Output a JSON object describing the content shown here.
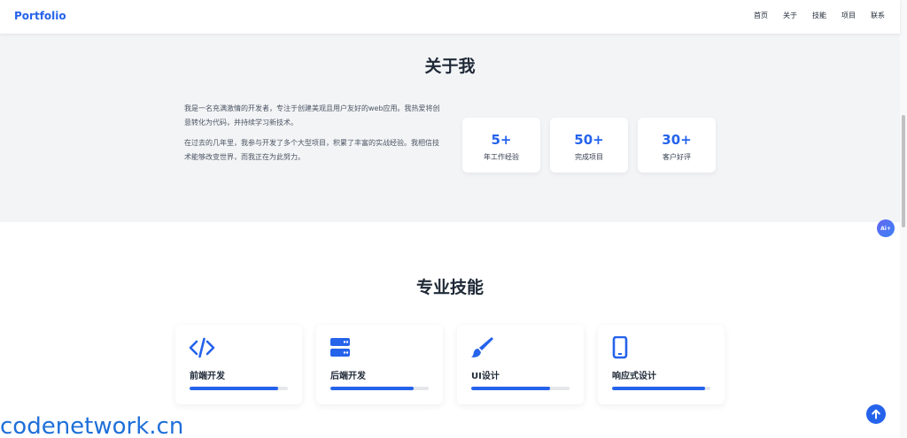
{
  "nav": {
    "logo": "Portfolio",
    "links": [
      "首页",
      "关于",
      "技能",
      "项目",
      "联系"
    ]
  },
  "about": {
    "title": "关于我",
    "paragraphs": [
      "我是一名充满激情的开发者，专注于创建美观且用户友好的web应用。我热爱将创意转化为代码，并持续学习新技术。",
      "在过去的几年里，我参与开发了多个大型项目，积累了丰富的实战经验。我相信技术能够改变世界，而我正在为此努力。"
    ],
    "stats": [
      {
        "value": "5+",
        "label": "年工作经验"
      },
      {
        "value": "50+",
        "label": "完成项目"
      },
      {
        "value": "30+",
        "label": "客户好评"
      }
    ]
  },
  "ai_badge": "Ai+",
  "skills": {
    "title": "专业技能",
    "items": [
      {
        "name": "前端开发",
        "icon": "code-icon",
        "level": 0.9
      },
      {
        "name": "后端开发",
        "icon": "server-icon",
        "level": 0.85
      },
      {
        "name": "UI设计",
        "icon": "brush-icon",
        "level": 0.8
      },
      {
        "name": "响应式设计",
        "icon": "mobile-icon",
        "level": 0.95
      }
    ]
  },
  "watermark": "codenetwork.cn",
  "colors": {
    "accent": "#2563eb",
    "section_bg": "#f3f4f6",
    "text": "#1f2937"
  }
}
